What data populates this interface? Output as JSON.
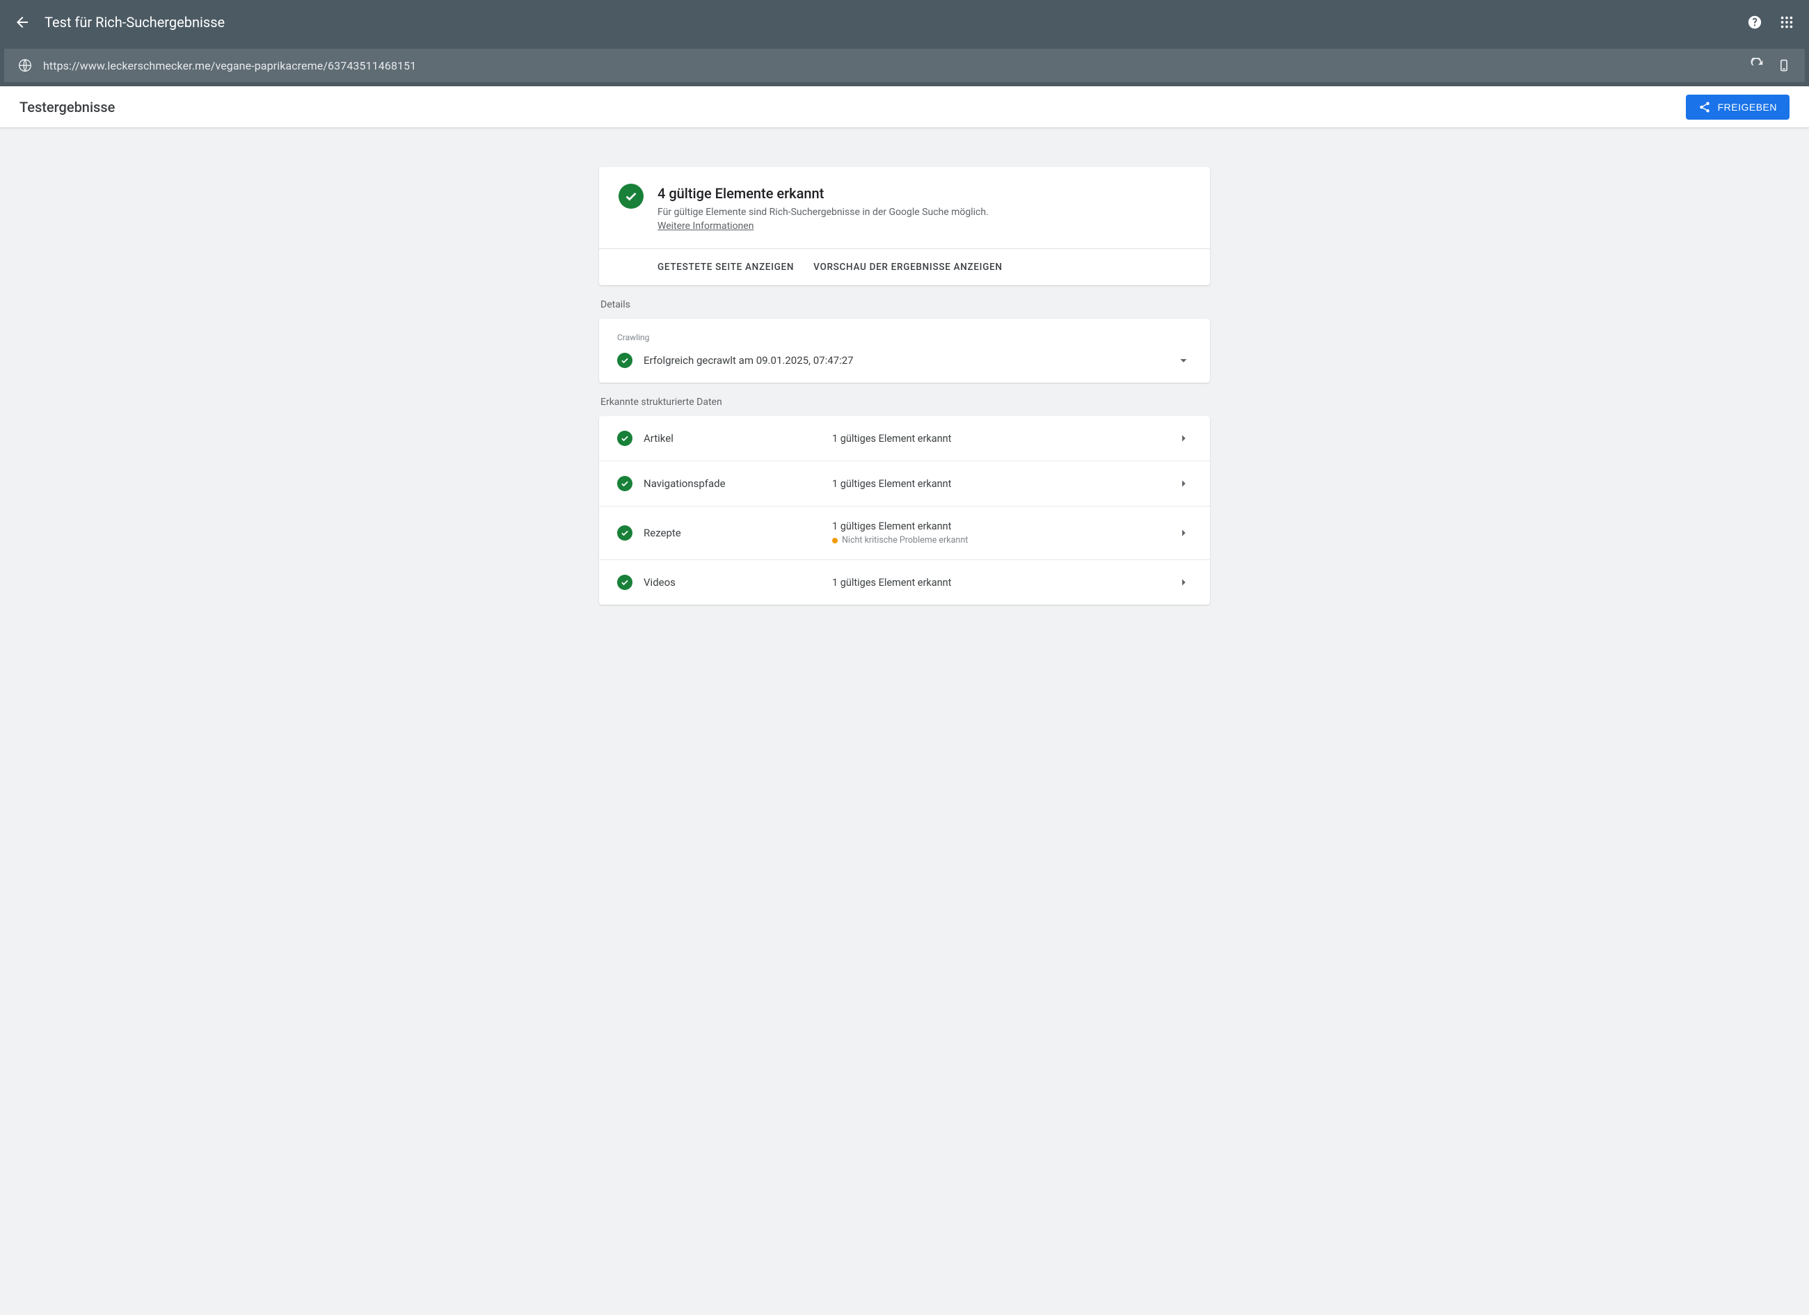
{
  "header": {
    "title": "Test für Rich-Suchergebnisse"
  },
  "urlbar": {
    "url": "https://www.leckerschmecker.me/vegane-paprikacreme/63743511468151"
  },
  "subheader": {
    "title": "Testergebnisse",
    "share_label": "FREIGEBEN"
  },
  "summary": {
    "headline": "4 gültige Elemente erkannt",
    "description": "Für gültige Elemente sind Rich-Suchergebnisse in der Google Suche möglich.",
    "more_info": "Weitere Informationen",
    "action_tested_page": "GETESTETE SEITE ANZEIGEN",
    "action_preview": "VORSCHAU DER ERGEBNISSE ANZEIGEN"
  },
  "details": {
    "label": "Details",
    "crawling_label": "Crawling",
    "crawl_status": "Erfolgreich gecrawlt am 09.01.2025, 07:47:27"
  },
  "structured": {
    "label": "Erkannte strukturierte Daten",
    "items": [
      {
        "name": "Artikel",
        "status": "1 gültiges Element erkannt",
        "warning": null
      },
      {
        "name": "Navigationspfade",
        "status": "1 gültiges Element erkannt",
        "warning": null
      },
      {
        "name": "Rezepte",
        "status": "1 gültiges Element erkannt",
        "warning": "Nicht kritische Probleme erkannt"
      },
      {
        "name": "Videos",
        "status": "1 gültiges Element erkannt",
        "warning": null
      }
    ]
  }
}
